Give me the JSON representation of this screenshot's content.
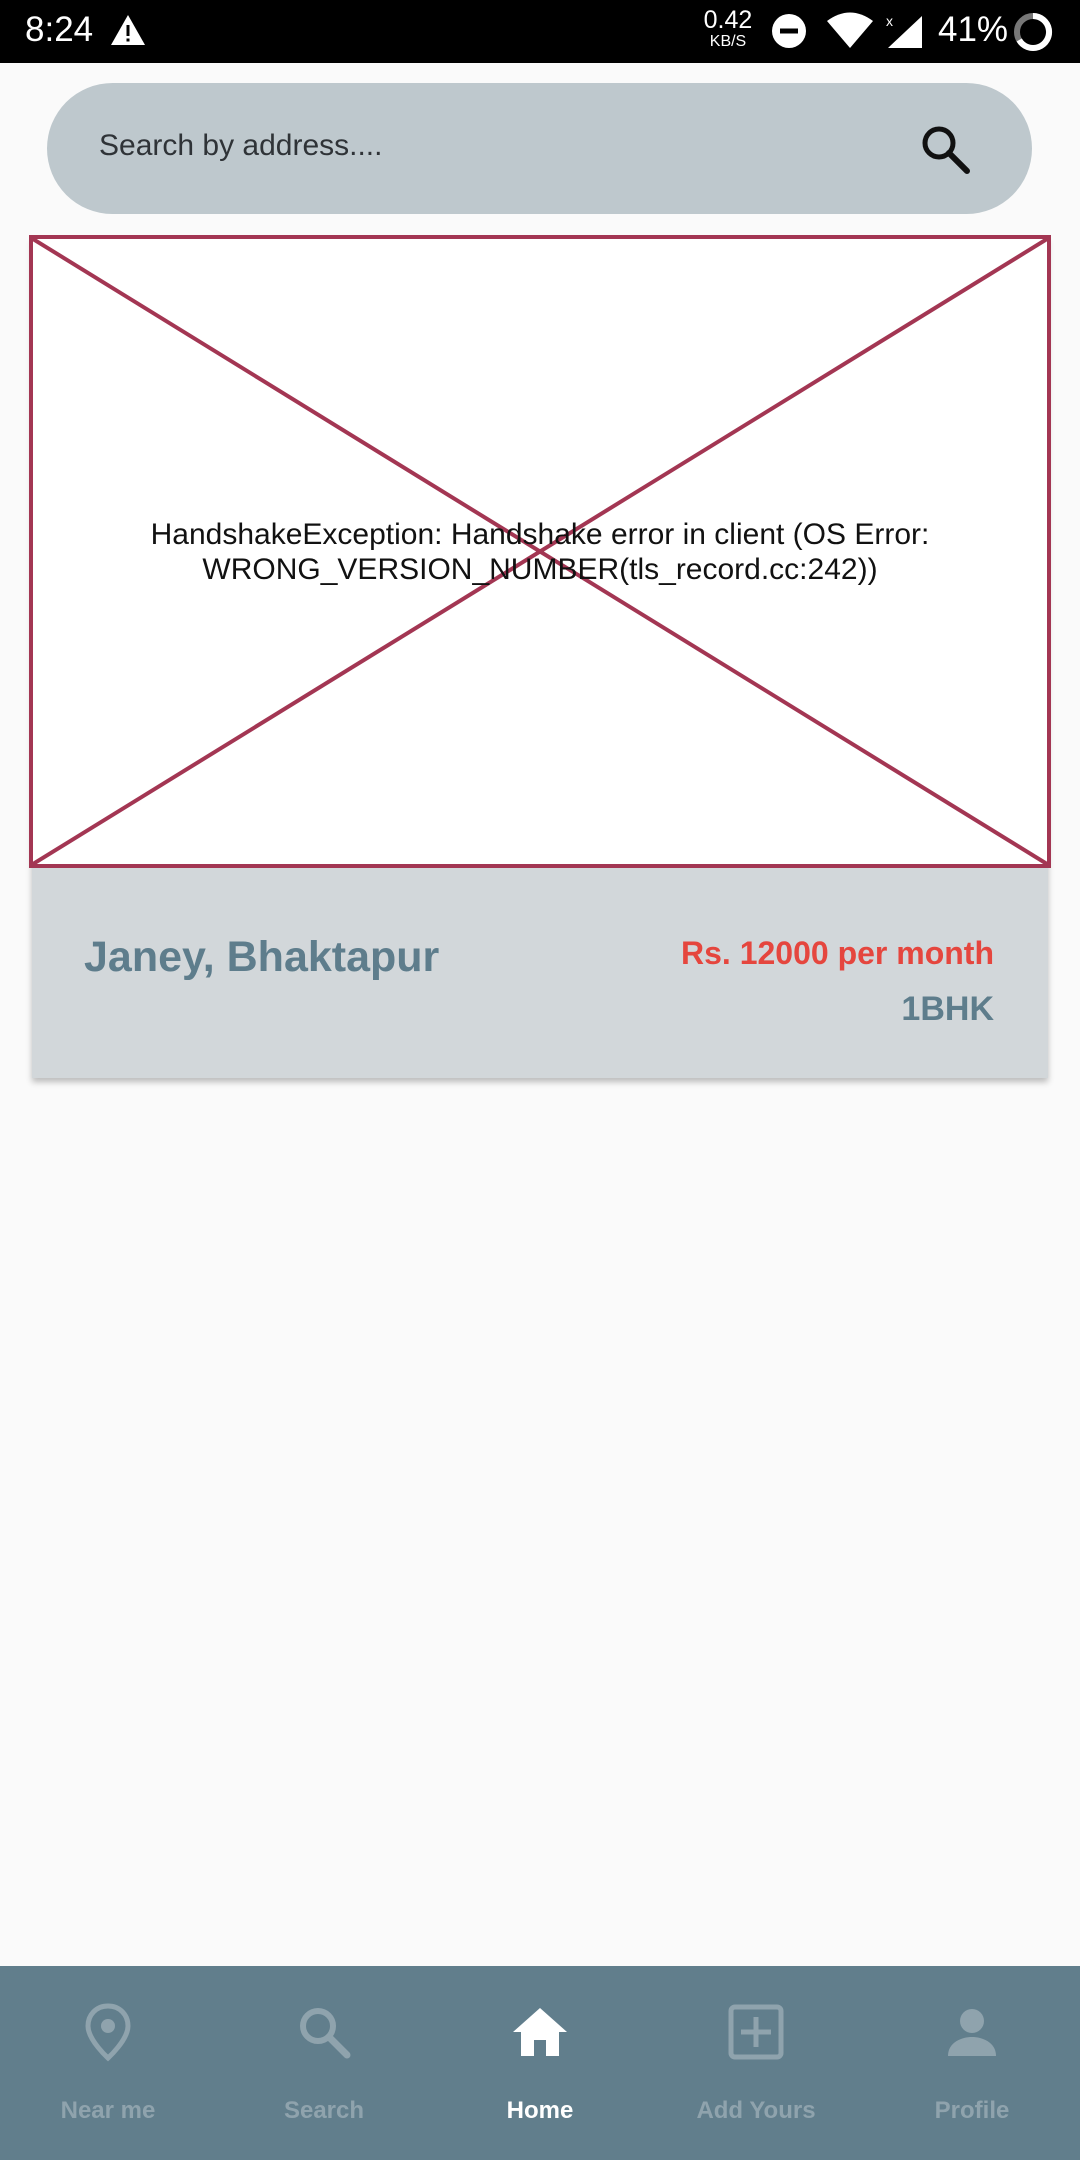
{
  "status_bar": {
    "time": "8:24",
    "speed_value": "0.42",
    "speed_unit": "KB/S",
    "battery": "41%",
    "icons": [
      "warning-icon",
      "dnd-icon",
      "wifi-icon",
      "signal-icon",
      "battery-icon"
    ]
  },
  "search": {
    "placeholder": "Search by address....",
    "icon": "search-icon"
  },
  "listing": {
    "image_error": "HandshakeException: Handshake error in client (OS Error: WRONG_VERSION_NUMBER(tls_record.cc:242))",
    "title": "Janey, Bhaktapur",
    "price": "Rs. 12000 per month",
    "type": "1BHK"
  },
  "nav": {
    "items": [
      {
        "label": "Near me",
        "icon": "location-pin-icon"
      },
      {
        "label": "Search",
        "icon": "search-icon"
      },
      {
        "label": "Home",
        "icon": "home-icon",
        "active": true
      },
      {
        "label": "Add Yours",
        "icon": "add-box-icon"
      },
      {
        "label": "Profile",
        "icon": "person-icon"
      }
    ]
  },
  "colors": {
    "search_bar": "#bec8cd",
    "card": "#d2d7da",
    "accent": "#5e7d8c",
    "price": "#e5463e",
    "nav_bg": "#617e8c",
    "error_border": "#a33653"
  }
}
